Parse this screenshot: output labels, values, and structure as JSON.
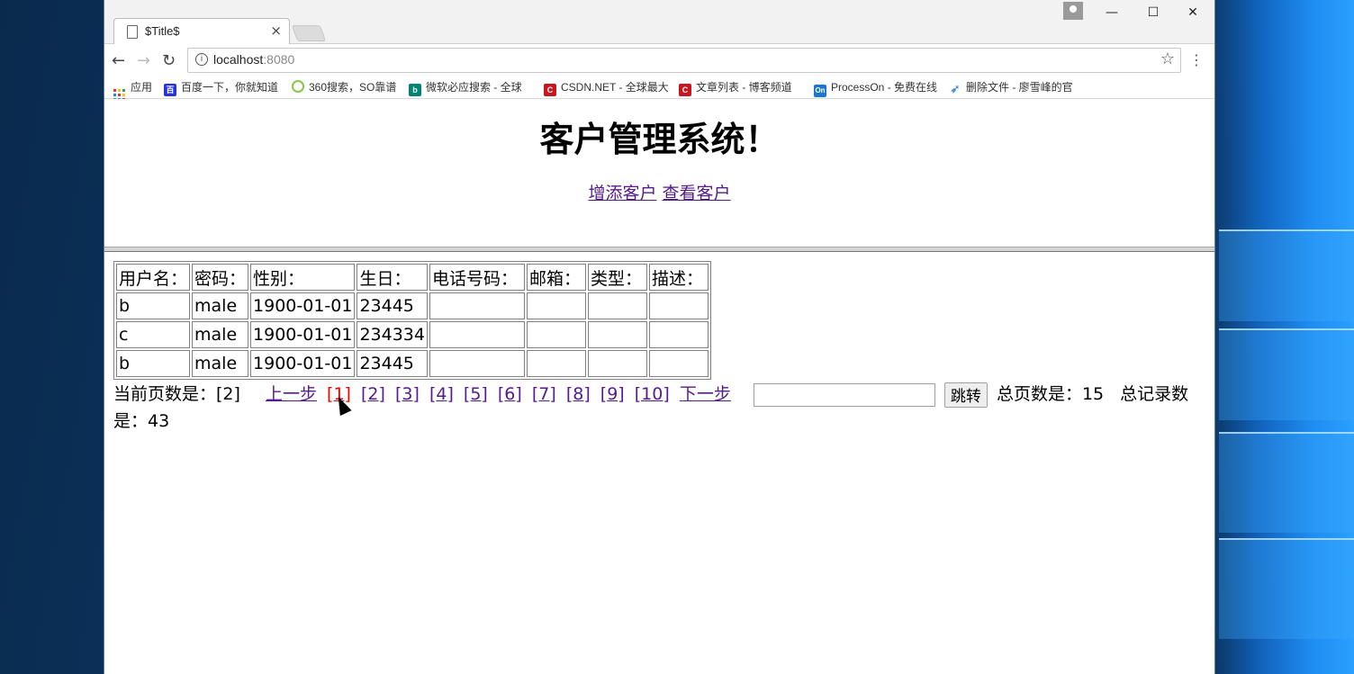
{
  "browser": {
    "tab_title": "$Title$",
    "tab_close": "×",
    "url_host": "localhost",
    "url_port": ":8080",
    "window_controls": {
      "minimize": "—",
      "maximize": "☐",
      "close": "✕"
    },
    "nav": {
      "back": "←",
      "forward": "→",
      "reload": "↻",
      "menu": "⋮",
      "star": "☆"
    }
  },
  "bookmarks": [
    {
      "label": "应用",
      "icon": "apps-icon"
    },
    {
      "label": "百度一下，你就知道",
      "icon": "baidu-icon",
      "color": "#2932e1",
      "glyph": "百"
    },
    {
      "label": "360搜索，SO靠谱",
      "icon": "so360-icon",
      "color": "#4caf50",
      "glyph": "○"
    },
    {
      "label": "微软必应搜索 - 全球",
      "icon": "bing-icon",
      "color": "#008373",
      "glyph": "b"
    },
    {
      "label": "CSDN.NET - 全球最大",
      "icon": "csdn-icon",
      "color": "#c9151e",
      "glyph": "C"
    },
    {
      "label": "文章列表 - 博客频道",
      "icon": "csdn-blog-icon",
      "color": "#c9151e",
      "glyph": "C"
    },
    {
      "label": "ProcessOn - 免费在线",
      "icon": "processon-icon",
      "color": "#1976d2",
      "glyph": "On"
    },
    {
      "label": "删除文件 - 廖雪峰的官",
      "icon": "rocket-icon",
      "color": "#4a90d9",
      "glyph": "➶"
    }
  ],
  "header": {
    "title": "客户管理系统！",
    "link_add": "增添客户",
    "link_view": "查看客户"
  },
  "table": {
    "columns": [
      "用户名：",
      "密码：",
      "性别：",
      "生日：",
      "电话号码：",
      "邮箱：",
      "类型：",
      "描述："
    ],
    "rows": [
      [
        "b",
        "male",
        "1900-01-01",
        "23445",
        "",
        "",
        "",
        ""
      ],
      [
        "c",
        "male",
        "1900-01-01",
        "234334",
        "",
        "",
        "",
        ""
      ],
      [
        "b",
        "male",
        "1900-01-01",
        "23445",
        "",
        "",
        "",
        ""
      ]
    ]
  },
  "pager": {
    "current_label": "当前页数是：[2]",
    "prev": "上一步",
    "pages": [
      "[1]",
      "[2]",
      "[3]",
      "[4]",
      "[5]",
      "[6]",
      "[7]",
      "[8]",
      "[9]",
      "[10]"
    ],
    "active_page": "[1]",
    "next": "下一步",
    "jump_input_value": "",
    "jump_button": "跳转",
    "total_pages": "总页数是：15",
    "total_records": "总记录数是：43"
  }
}
